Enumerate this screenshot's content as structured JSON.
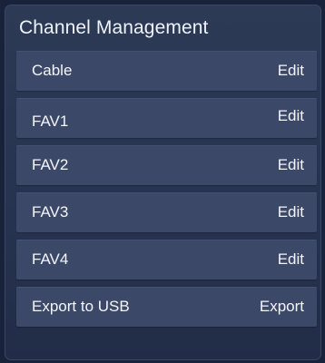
{
  "header": {
    "title": "Channel Management"
  },
  "rows": [
    {
      "label": "Cable",
      "action": "Edit"
    },
    {
      "label": "FAV1",
      "action": "Edit"
    },
    {
      "label": "FAV2",
      "action": "Edit"
    },
    {
      "label": "FAV3",
      "action": "Edit"
    },
    {
      "label": "FAV4",
      "action": "Edit"
    },
    {
      "label": "Export to USB",
      "action": "Export"
    }
  ],
  "colors": {
    "background": "#18223a",
    "panel": "#2a3753",
    "row": "#3b4868",
    "text": "#f3f5fa"
  }
}
